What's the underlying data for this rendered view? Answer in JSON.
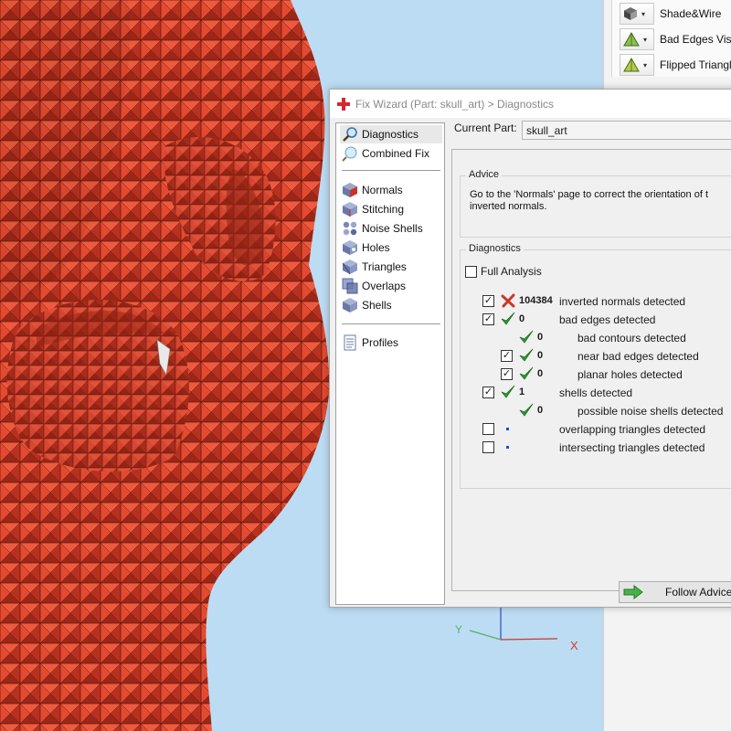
{
  "toolbar": {
    "items": [
      {
        "label": "Shade&Wire",
        "icon": "cube-icon"
      },
      {
        "label": "Bad Edges Visib",
        "icon": "triangle-icon"
      },
      {
        "label": "Flipped Triangle",
        "icon": "triangle-icon"
      }
    ]
  },
  "dialog": {
    "title": "Fix Wizard (Part: skull_art) > Diagnostics",
    "current_part_label": "Current Part:",
    "current_part_value": "skull_art",
    "follow_advice_label": "Follow Advice"
  },
  "nav": {
    "diagnostics": "Diagnostics",
    "combined_fix": "Combined Fix",
    "normals": "Normals",
    "stitching": "Stitching",
    "noise_shells": "Noise Shells",
    "holes": "Holes",
    "triangles": "Triangles",
    "overlaps": "Overlaps",
    "shells": "Shells",
    "profiles": "Profiles"
  },
  "advice": {
    "title": "Advice",
    "text": "Go to the 'Normals' page to correct the orientation of t\ninverted normals."
  },
  "diagnostics": {
    "title": "Diagnostics",
    "full_analysis_label": "Full Analysis",
    "full_analysis_checked": false,
    "rows": [
      {
        "checked": true,
        "status": "fail",
        "count": "104384",
        "message": "inverted normals detected"
      },
      {
        "checked": true,
        "status": "ok",
        "count": "0",
        "message": "bad edges detected"
      },
      {
        "checked": null,
        "status": "ok",
        "count": "0",
        "message": "bad contours detected"
      },
      {
        "checked": true,
        "status": "ok",
        "count": "0",
        "message": "near bad edges detected"
      },
      {
        "checked": true,
        "status": "ok",
        "count": "0",
        "message": "planar holes detected"
      },
      {
        "checked": true,
        "status": "ok",
        "count": "1",
        "message": "shells detected"
      },
      {
        "checked": null,
        "status": "ok",
        "count": "0",
        "message": "possible noise shells detected"
      },
      {
        "checked": false,
        "status": "none",
        "count": "",
        "message": "overlapping triangles detected"
      },
      {
        "checked": false,
        "status": "none",
        "count": "",
        "message": "intersecting triangles detected"
      }
    ]
  },
  "axes": {
    "x_label": "X",
    "y_label": "Y"
  },
  "colors": {
    "mesh": "#d8402e",
    "mesh_shadow": "#a82a1c",
    "viewport_bg": "#bcdcf4",
    "ok": "#2c9a2c",
    "fail": "#c83a28"
  }
}
